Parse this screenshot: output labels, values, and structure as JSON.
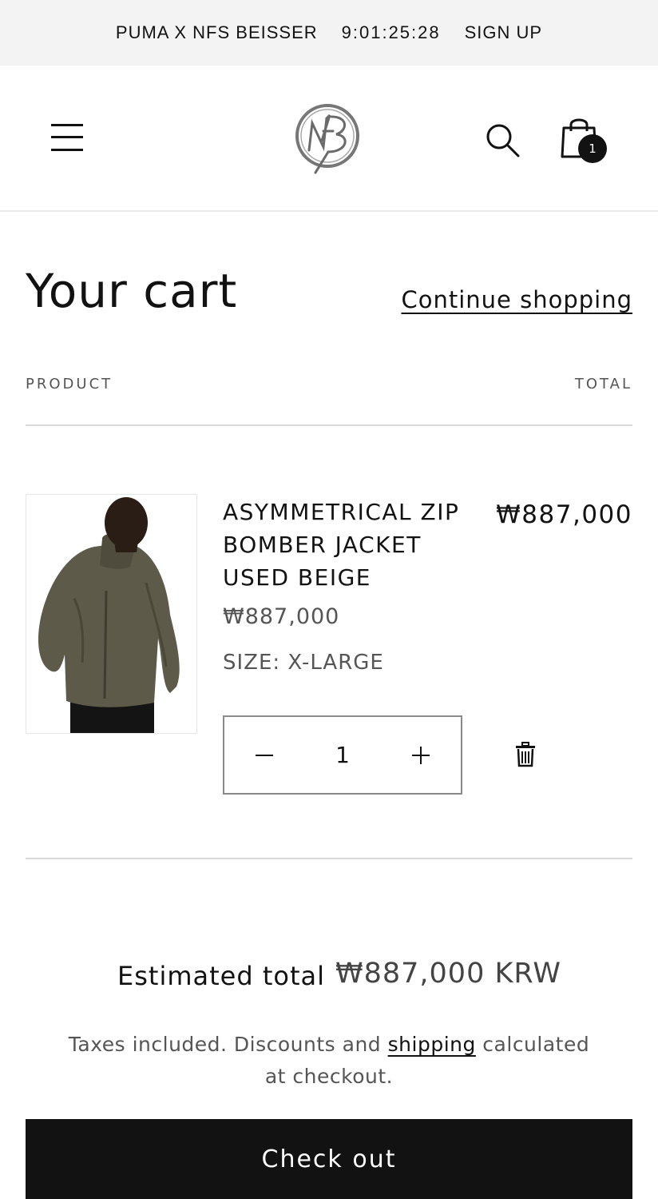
{
  "announcement": {
    "promo_text": "PUMA X NFS BEISSER",
    "countdown": "9:01:25:28",
    "signup_label": "SIGN UP"
  },
  "header": {
    "menu_icon": "hamburger-menu-icon",
    "logo_text": "NFS",
    "search_icon": "search-icon",
    "cart_icon": "shopping-bag-icon",
    "cart_count": "1"
  },
  "cart": {
    "title": "Your cart",
    "continue_label": "Continue shopping",
    "col_product": "PRODUCT",
    "col_total": "TOTAL",
    "items": [
      {
        "name": "ASYMMETRICAL ZIP BOMBER JACKET USED BEIGE",
        "unit_price": "₩887,000",
        "size": "SIZE: X-LARGE",
        "quantity": "1",
        "line_total": "₩887,000"
      }
    ],
    "estimated_label": "Estimated total",
    "estimated_value": "₩887,000 KRW",
    "note_before": "Taxes included. Discounts and ",
    "note_link": "shipping",
    "note_after": " calculated at checkout.",
    "checkout_label": "Check out"
  },
  "colors": {
    "text": "#121212",
    "muted": "#555555",
    "announcement_bg": "#f3f3f3",
    "button_bg": "#121212"
  }
}
